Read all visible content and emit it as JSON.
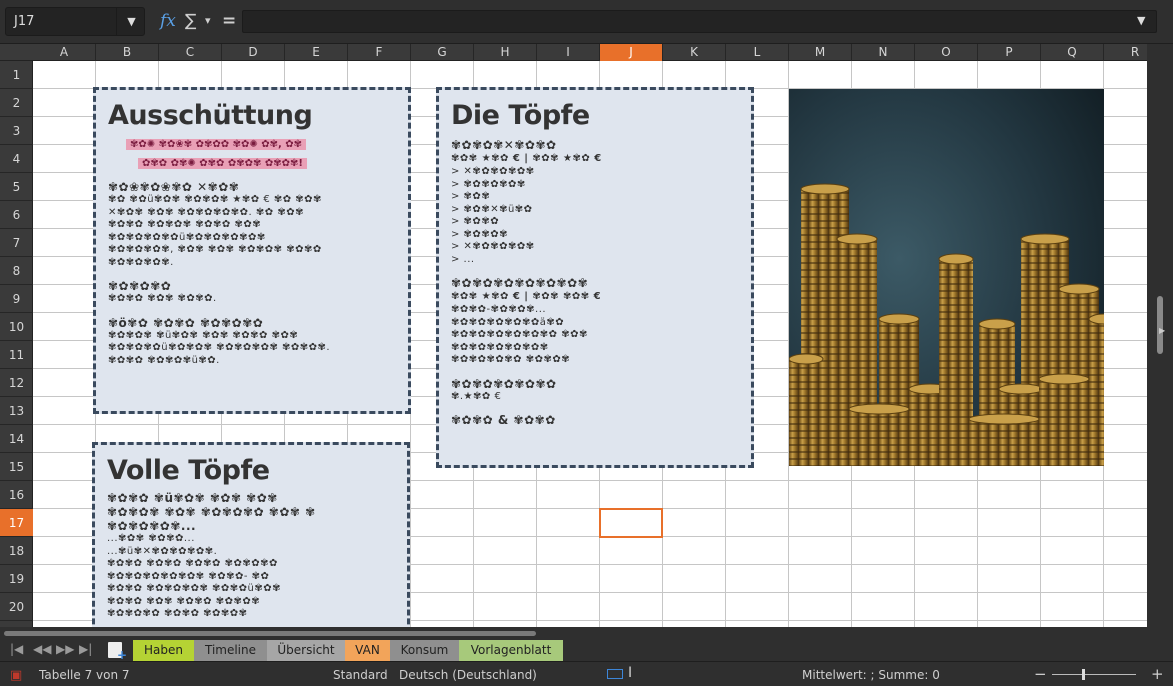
{
  "name_box": {
    "value": "J17"
  },
  "formula_bar": {
    "fx_icon": "fx",
    "sum_icon": "∑",
    "sum_dropdown": "▾",
    "equals_icon": "=",
    "value": ""
  },
  "columns": [
    "A",
    "B",
    "C",
    "D",
    "E",
    "F",
    "G",
    "H",
    "I",
    "J",
    "K",
    "L",
    "M",
    "N",
    "O",
    "P",
    "Q",
    "R"
  ],
  "rows": [
    "1",
    "2",
    "3",
    "4",
    "5",
    "6",
    "7",
    "8",
    "9",
    "10",
    "11",
    "12",
    "13",
    "14",
    "15",
    "16",
    "17",
    "18",
    "19",
    "20"
  ],
  "active_column": "J",
  "active_row": "17",
  "panels": {
    "ausschuettung": {
      "title": "Ausschüttung",
      "highlight_1": "✾✿✺ ✾✿❀✾ ✿✾✿✿ ✾✿✺ ✿✾, ✿✾",
      "highlight_2": "✿✾✿ ✿✾✺ ✿✾✿ ✿✾✿✾ ✿✾✿✾!",
      "line_1": "✾✿❀✾✿❀✾✿ ✕✾✿✾",
      "line_2": "✾✿ ✾✿ü✾✿✾ ✾✿✾✿✾ ★✾✿ € ✾✿ ✾✿✾",
      "line_3": "✕✾✿✾ ✾✿✾ ✾✿✾✿✾✿✾✿. ✾✿ ✾✿✾",
      "line_4": "✾✿✾✿ ✾✿✾✿✾ ✾✿✾✿ ✾✿✾",
      "line_5": "✾✿✾✿✾✿✾✿ü✾✿✾✿✾✿✾✿✾",
      "line_6": "✾✿✾✿✾✿✾, ✾✿✾ ✾✿✾ ✾✿✾✿✾ ✾✿✾✿",
      "line_7": "✾✿✾✿✾✿✾.",
      "line_8": "✾✿✾✿✾✿",
      "line_9": "✾✿✾✿ ✾✿✾ ✾✿✾✿.",
      "line_10": "✾ö✾✿ ✾✿✾✿ ✾✿✾✿✾✿",
      "line_11": "✾✿✾✿✾ ✾ü✾✿✾ ✾✿✾ ✾✿✾✿ ✾✿✾",
      "line_12": "✾✿✾✿✾✿ü✾✿✾✿✾ ✾✿✾✿✾✿✾ ✾✿✾✿✾.",
      "line_13": "✾✿✾✿ ✾✿✾✿✾ü✾✿."
    },
    "die_toepfe": {
      "title": "Die Töpfe",
      "line_1": "✾✿✾✿✾✕✾✿✾✿",
      "line_2": "✾✿✾ ★✾✿ € | ✾✿✾ ★✾✿ €",
      "bullets": [
        "> ✕✾✿✾✿✾✿✾",
        "> ✾✿✾✿✾✿✾",
        "> ✾✿✾",
        "> ✾✿✾✕✾ü✾✿",
        "> ✾✿✾✿",
        "> ✾✿✾✿✾",
        "> ✕✾✿✾✿✾✿✾",
        "> ..."
      ],
      "line_3": "✾✿✾✿✾✿✾✿✾✿✾✿✾",
      "line_4": "✾✿✾ ★✾✿ € | ✾✿✾ ✾✿✾ €",
      "line_5": "✾✿✾✿-✾✿✾✿✾...",
      "line_6": "✾✿✾✿✾✿✾✿✾✿ä✾✿",
      "line_7": "✾✿✾✿✾✿✾✿✾✿✾✿ ✾✿✾",
      "line_8": "✾✿✾✿✾✿✾✿✾✿✾",
      "line_9": "✾✿✾✿✾✿✾✿ ✾✿✾✿✾",
      "line_10": "✾✿✾✿✾✿✾✿✾✿",
      "line_11": "✾.★✾✿ €",
      "line_12": "✾✿✾✿ & ✾✿✾✿"
    },
    "volle_toepfe": {
      "title": "Volle Töpfe",
      "line_1": "✾✿✾✿ ✾ü✾✿✾ ✾✿✾ ✾✿✾",
      "line_2": "✾✿✾✿✾ ✾✿✾ ✾✿✾✿✾✿ ✾✿✾ ✾",
      "line_3": "✾✿✾✿✾✿✾...",
      "line_4": "...✾✿✾ ✾✿✾✿...",
      "line_5": "...✾ü✾✕✾✿✾✿✾✿✾.",
      "line_6": "✾✿✾✿ ✾✿✾✿ ✾✿✾✿ ✾✿✾✿✾✿",
      "line_7": "✾✿✾✿✾✿✾✿✾✿✾ ✾✿✾✿- ✾✿",
      "line_8": "✾✿✾✿ ✾✿✾✿✾✿✾ ✾✿✾✿ü✾✿✾",
      "line_9": "✾✿✾✿ ✾✿✾ ✾✿✾✿ ✾✿✾✿✾",
      "line_10": "✾✿✾✿✾✿ ✾✿✾✿ ✾✿✾✿✾"
    }
  },
  "sheet_tabs": [
    {
      "label": "Haben",
      "color": "#b5d334"
    },
    {
      "label": "Timeline",
      "color": "#8f8f8f"
    },
    {
      "label": "Übersicht",
      "color": "#a6a6a6"
    },
    {
      "label": "VAN",
      "color": "#f2a45a"
    },
    {
      "label": "Konsum",
      "color": "#8f8f8f"
    },
    {
      "label": "Vorlagenblatt",
      "color": "#a7c97b"
    }
  ],
  "status_bar": {
    "sheet_info": "Tabelle 7 von 7",
    "style": "Standard",
    "language": "Deutsch (Deutschland)",
    "summary": "Mittelwert: ; Summe: 0",
    "zoom_minus": "−",
    "zoom_plus": "+"
  },
  "colors": {
    "accent": "#e8702a",
    "panel_bg": "#dfe5ee",
    "panel_border": "#3a4a5e"
  }
}
